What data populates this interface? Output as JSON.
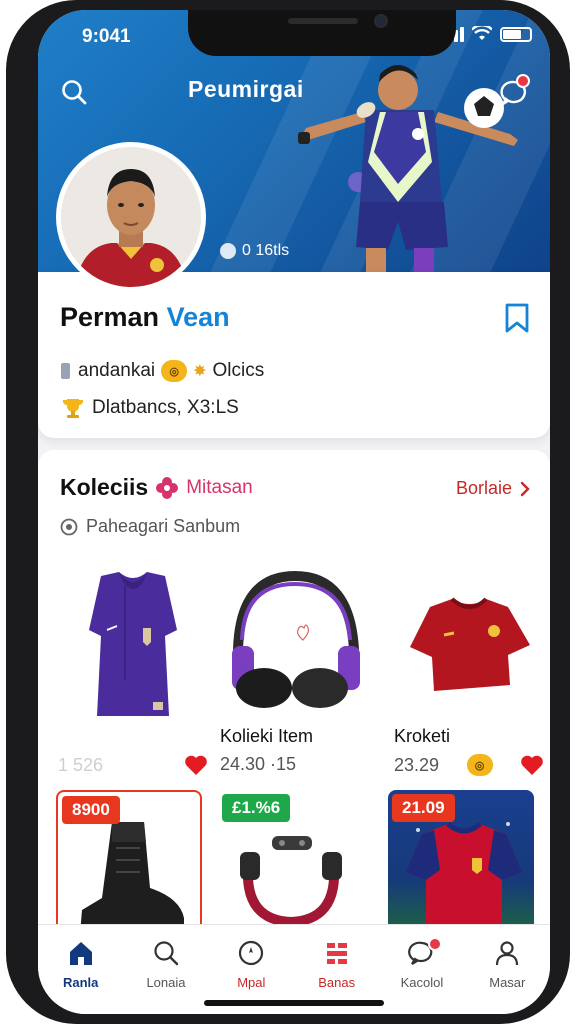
{
  "status_bar": {
    "time": "9:041"
  },
  "header": {
    "app_title": "Peumirgai",
    "followers_text": "0 16tls",
    "colors": {
      "hero_start": "#1f7fc8",
      "hero_end": "#0f3f86",
      "accent": "#1684d6"
    }
  },
  "profile": {
    "name_primary": "Perman",
    "name_accent": "Vean",
    "rank_label": "andankai",
    "points_label": "Olcics",
    "stats_label": "Dlatbancs, X3:LS"
  },
  "collection": {
    "title": "Koleciis",
    "subtitle": "Mitasan",
    "see_all": "Borlaie",
    "meta": "Paheagari Sanbum",
    "items": [
      {
        "name": "",
        "price": "1 526",
        "icon": "purple-jersey-icon"
      },
      {
        "name": "Kolieki Item",
        "price": "24.30 ·15",
        "icon": "headphones-icon"
      },
      {
        "name": "Kroketi",
        "price": "23.29",
        "icon": "red-shirt-icon"
      }
    ],
    "tiles": [
      {
        "tag": "8900",
        "tag_color": "#e8371f",
        "icon": "boot-icon"
      },
      {
        "tag": "£1.%6",
        "tag_color": "#1fa84a",
        "icon": "neck-headphones-icon"
      },
      {
        "tag": "21.09",
        "tag_color": "#e8371f",
        "icon": "stadium-jersey-icon"
      }
    ]
  },
  "nav": {
    "items": [
      {
        "label": "Ranla",
        "icon": "home-icon",
        "state": "active"
      },
      {
        "label": "Lonaia",
        "icon": "search-icon",
        "state": ""
      },
      {
        "label": "Mpal",
        "icon": "compass-icon",
        "state": "alert"
      },
      {
        "label": "Banas",
        "icon": "grid-icon",
        "state": "alert"
      },
      {
        "label": "Kacolol",
        "icon": "chat-icon",
        "state": ""
      },
      {
        "label": "Masar",
        "icon": "profile-icon",
        "state": ""
      }
    ]
  }
}
